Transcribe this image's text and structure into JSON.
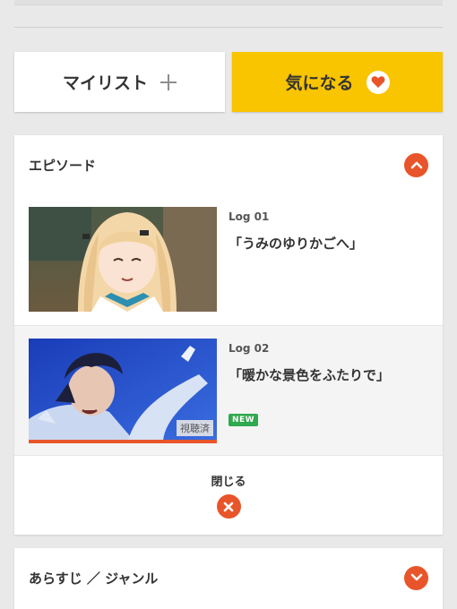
{
  "actions": {
    "mylist_label": "マイリスト",
    "kininaru_label": "気になる"
  },
  "episodes_panel": {
    "title": "エピソード",
    "items": [
      {
        "log": "Log 01",
        "title": "「うみのゆりかごへ」",
        "watched": "",
        "new": ""
      },
      {
        "log": "Log 02",
        "title": "「暖かな景色をふたりで」",
        "watched": "視聴済",
        "new": "NEW"
      }
    ],
    "close_label": "閉じる"
  },
  "synopsis_panel": {
    "title": "あらすじ ／ ジャンル"
  },
  "colors": {
    "accent": "#e8552a",
    "kininaru_bg": "#f9c400",
    "new_badge": "#2fa84f",
    "page_bg": "#e9e9e9"
  },
  "icons": [
    "plus-icon",
    "heart-icon",
    "chevron-up-icon",
    "close-icon",
    "chevron-down-icon"
  ]
}
